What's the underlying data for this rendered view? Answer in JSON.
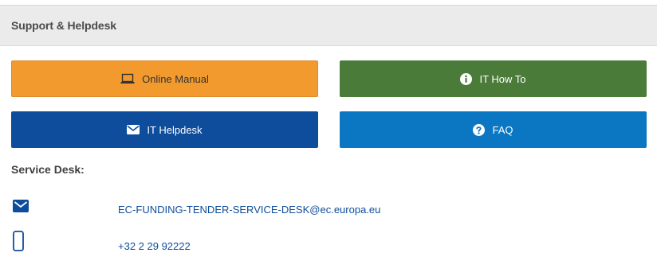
{
  "panel": {
    "title": "Support & Helpdesk"
  },
  "buttons": {
    "online_manual": {
      "label": "Online Manual",
      "icon": "laptop-icon",
      "color": "#f29a2e"
    },
    "it_how_to": {
      "label": "IT How To",
      "icon": "info-icon",
      "color": "#4a7b39"
    },
    "it_helpdesk": {
      "label": "IT Helpdesk",
      "icon": "envelope-icon",
      "color": "#0e4c9c"
    },
    "faq": {
      "label": "FAQ",
      "icon": "question-icon",
      "color": "#0b77c2"
    }
  },
  "service_desk": {
    "label": "Service Desk:",
    "email": {
      "icon": "envelope-icon",
      "value": "EC-FUNDING-TENDER-SERVICE-DESK@ec.europa.eu"
    },
    "phone": {
      "icon": "mobile-phone-icon",
      "value": "+32 2 29 92222"
    }
  }
}
